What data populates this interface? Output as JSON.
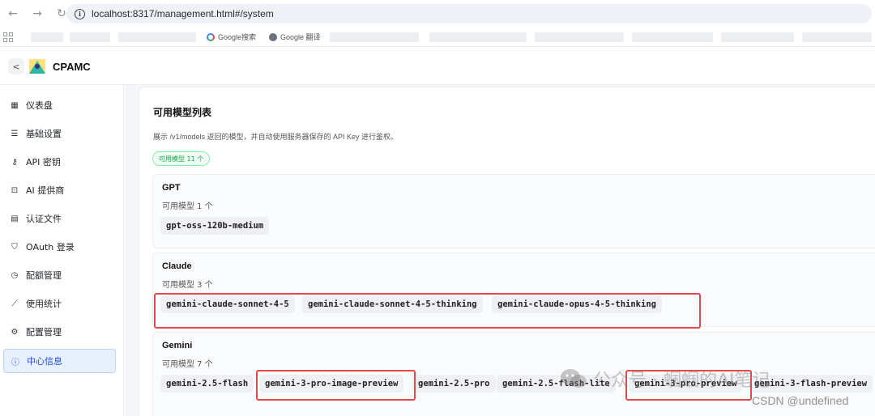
{
  "browser": {
    "url": "localhost:8317/management.html#/system",
    "bookmarks": [
      "Google搜索",
      "Google 翻译"
    ]
  },
  "app": {
    "title": "CPAMC",
    "back_label": "<"
  },
  "sidebar": {
    "items": [
      {
        "label": "仪表盘",
        "icon": "dashboard-icon"
      },
      {
        "label": "基础设置",
        "icon": "sliders-icon"
      },
      {
        "label": "API 密钥",
        "icon": "key-icon"
      },
      {
        "label": "AI 提供商",
        "icon": "robot-icon"
      },
      {
        "label": "认证文件",
        "icon": "file-icon"
      },
      {
        "label": "OAuth 登录",
        "icon": "shield-icon"
      },
      {
        "label": "配额管理",
        "icon": "timer-icon"
      },
      {
        "label": "使用统计",
        "icon": "chart-icon"
      },
      {
        "label": "配置管理",
        "icon": "gear-icon"
      },
      {
        "label": "中心信息",
        "icon": "info-icon",
        "active": true
      }
    ]
  },
  "panel": {
    "title": "可用模型列表",
    "description": "展示 /v1/models 返回的模型，并自动使用服务器保存的 API Key 进行鉴权。",
    "count_badge": "可用模型 11 个",
    "groups": [
      {
        "title": "GPT",
        "subtitle": "可用模型  1  个",
        "models": [
          "gpt-oss-120b-medium"
        ]
      },
      {
        "title": "Claude",
        "subtitle": "可用模型  3  个",
        "models": [
          "gemini-claude-sonnet-4-5",
          "gemini-claude-sonnet-4-5-thinking",
          "gemini-claude-opus-4-5-thinking"
        ]
      },
      {
        "title": "Gemini",
        "subtitle": "可用模型  7  个",
        "models": [
          "gemini-2.5-flash",
          "gemini-3-pro-image-preview",
          "gemini-2.5-pro",
          "gemini-2.5-flash-lite",
          "gemini-3-pro-preview",
          "gemini-3-flash-preview"
        ]
      }
    ]
  },
  "watermark": {
    "text": "公众号 · 蝈蝈的AI笔记",
    "csdn": "CSDN @undefined"
  },
  "colors": {
    "accent": "#1d4ed8",
    "highlight": "#e5484d",
    "badge_green": "#16a34a"
  }
}
